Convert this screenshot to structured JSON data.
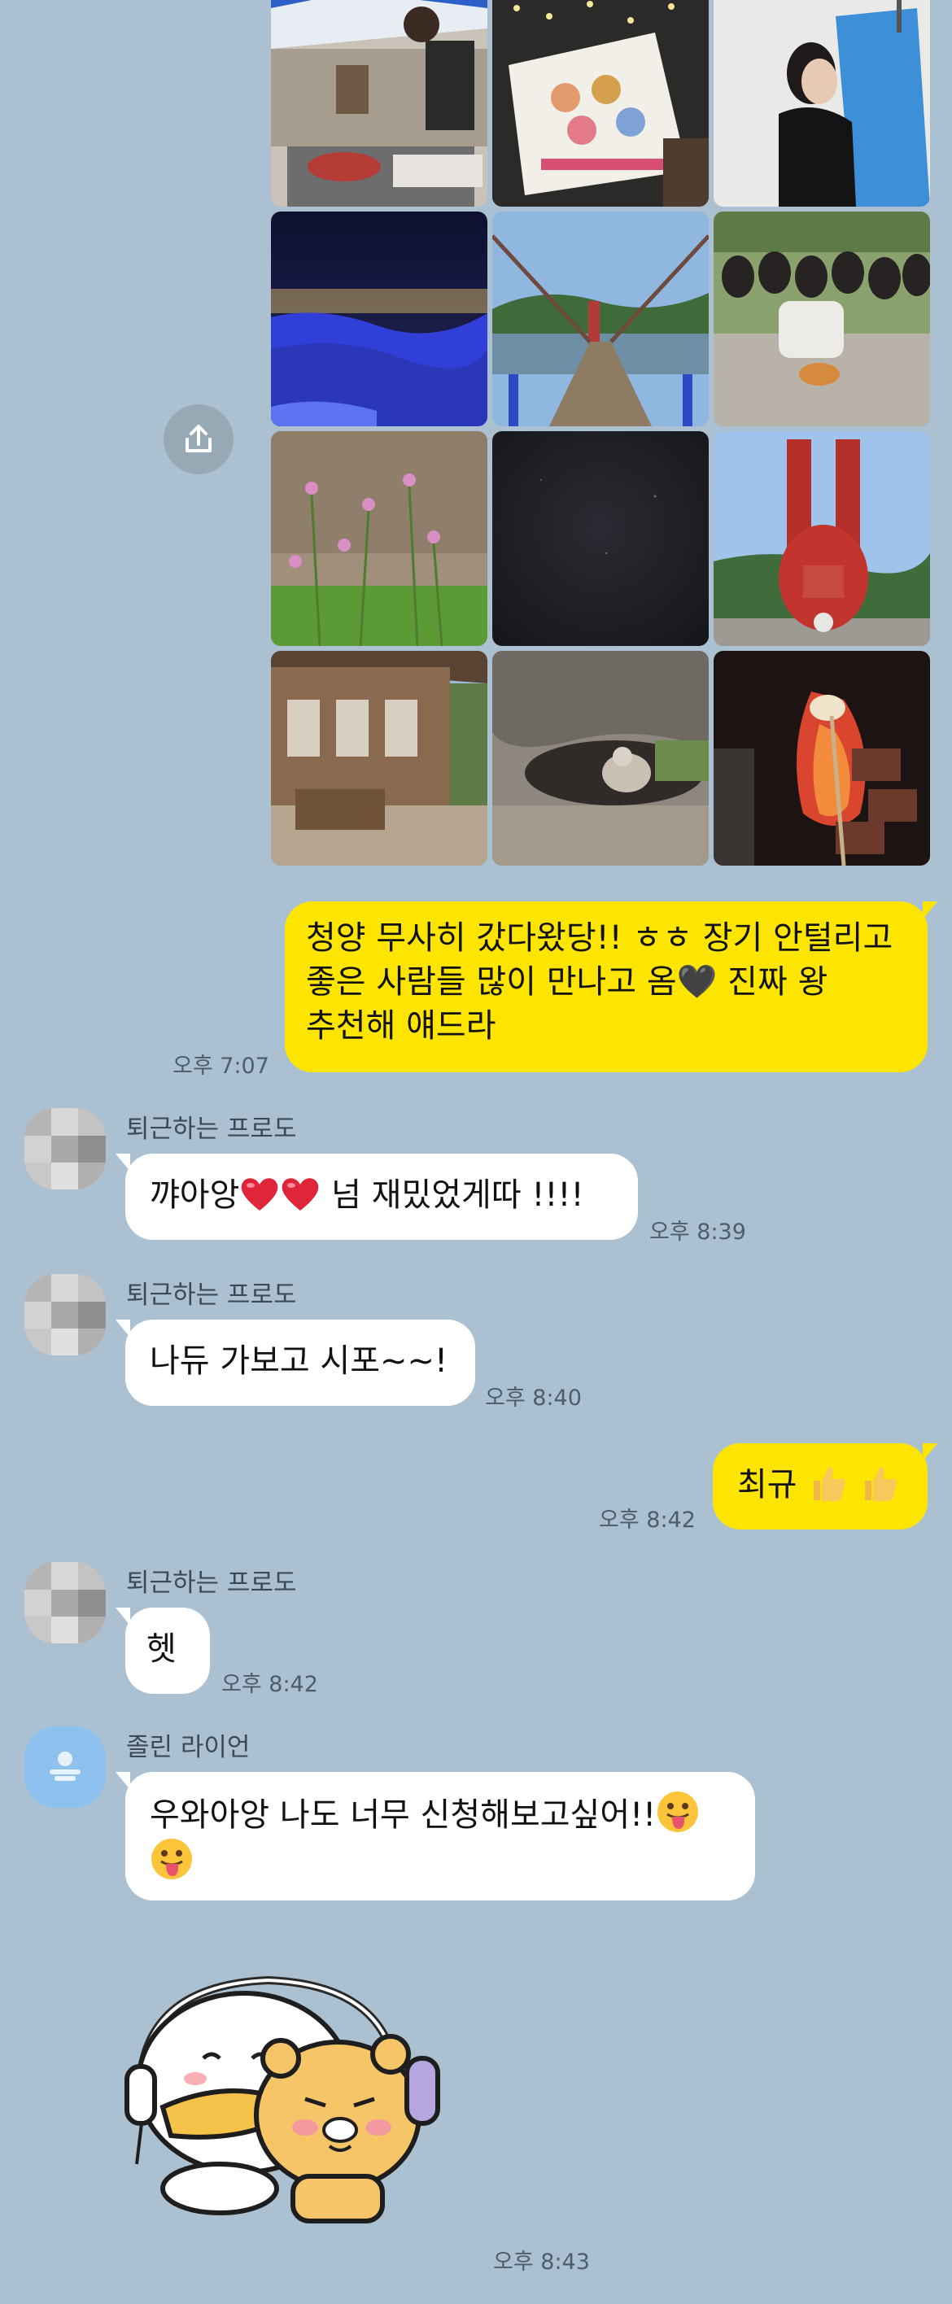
{
  "photos": [
    {
      "name": "photo-cooking-tent"
    },
    {
      "name": "photo-drawing-board"
    },
    {
      "name": "photo-woman-blue-backdrop"
    },
    {
      "name": "photo-night-city-view"
    },
    {
      "name": "photo-suspension-bridge"
    },
    {
      "name": "photo-jars-and-cat"
    },
    {
      "name": "photo-field-flowers"
    },
    {
      "name": "photo-dark-night-sky"
    },
    {
      "name": "photo-red-chili-monument"
    },
    {
      "name": "photo-traditional-house"
    },
    {
      "name": "photo-cat-under-rock"
    },
    {
      "name": "photo-campfire-marshmallow"
    }
  ],
  "messages": {
    "m1": {
      "text": "청양 무사히 갔다왔당!! ㅎㅎ 장기 안털리고 좋은 사람들 많이 만나고 옴🖤 진짜 왕 추천해 얘드라",
      "time": "오후 7:07"
    },
    "m2": {
      "sender": "퇴근하는 프로도",
      "text_a": "꺄아앙",
      "text_b": "넘 재밌었게따 !!!!",
      "time": "오후 8:39"
    },
    "m3": {
      "sender": "퇴근하는 프로도",
      "text": "나듀 가보고 시포~~!",
      "time": "오후 8:40"
    },
    "m4": {
      "text": "최규",
      "time": "오후 8:42"
    },
    "m5": {
      "sender": "퇴근하는 프로도",
      "text": "헷",
      "time": "오후 8:42"
    },
    "m6": {
      "sender": "졸린 라이언",
      "text": "우와아앙 나도 너무 신청해보고싶어!!",
      "time": "오후 8:43"
    }
  },
  "colors": {
    "background": "#abc1d1",
    "my_bubble": "#fee500",
    "other_bubble": "#ffffff"
  },
  "icons": {
    "share": "share-icon",
    "heart": "red-heart",
    "thumbs": "thumbs-up",
    "tongue": "face-with-tongue"
  }
}
